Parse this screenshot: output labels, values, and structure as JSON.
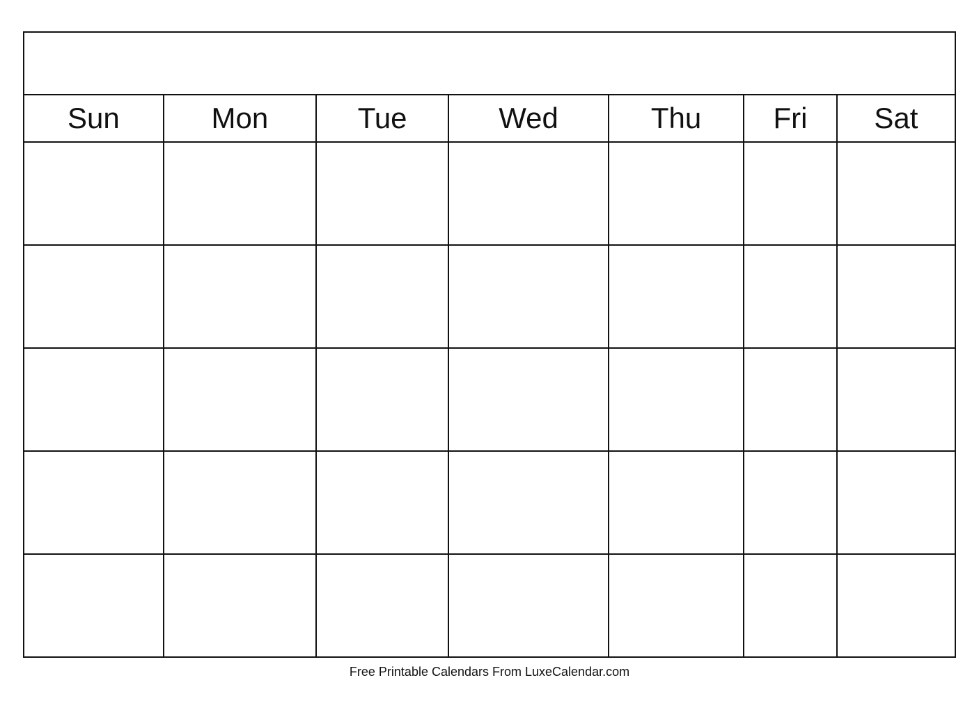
{
  "calendar": {
    "title": "",
    "days": [
      "Sun",
      "Mon",
      "Tue",
      "Wed",
      "Thu",
      "Fri",
      "Sat"
    ],
    "rows": 5
  },
  "footer": {
    "text": "Free Printable Calendars From LuxeCalendar.com"
  }
}
